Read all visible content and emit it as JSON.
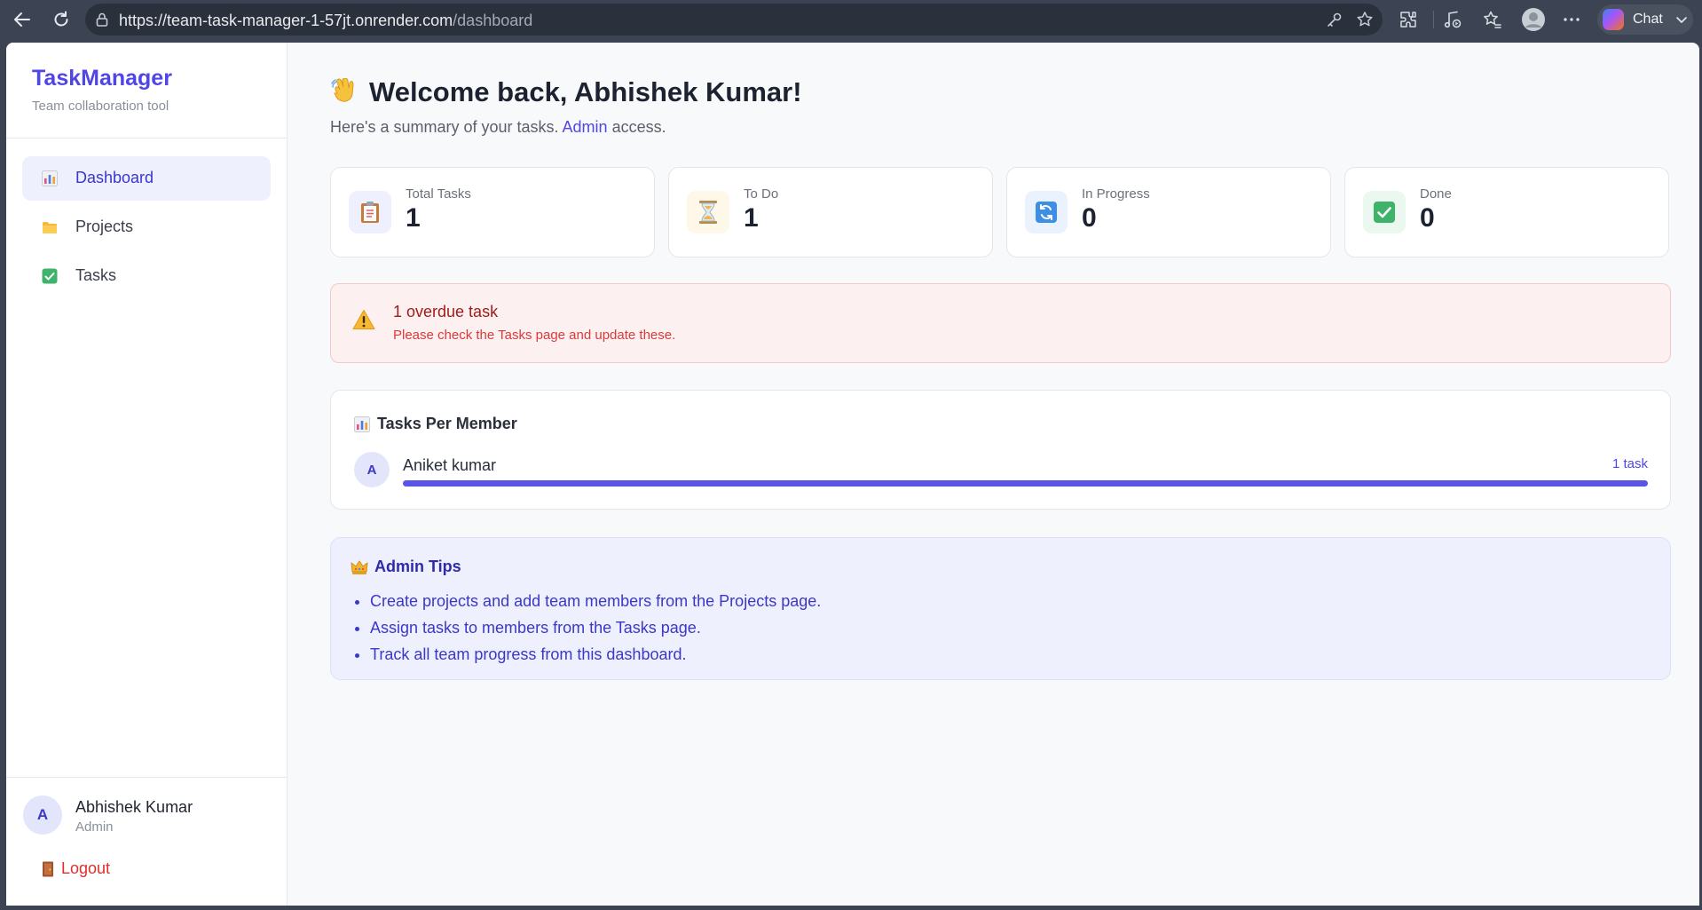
{
  "browser": {
    "url_base": "https://team-task-manager-1-57jt.onrender.com",
    "url_path": "/dashboard",
    "chat_label": "Chat"
  },
  "sidebar": {
    "brand": "TaskManager",
    "tagline": "Team collaboration tool",
    "items": [
      {
        "label": "Dashboard",
        "icon": "bar-chart-icon",
        "active": true
      },
      {
        "label": "Projects",
        "icon": "folder-icon",
        "active": false
      },
      {
        "label": "Tasks",
        "icon": "checkbox-icon",
        "active": false
      }
    ],
    "user": {
      "initial": "A",
      "name": "Abhishek Kumar",
      "role": "Admin"
    },
    "logout_label": "Logout"
  },
  "main": {
    "welcome_title": "Welcome back, Abhishek Kumar!",
    "welcome_sub_prefix": "Here's a summary of your tasks.",
    "welcome_role": "Admin",
    "welcome_sub_suffix": "access.",
    "stats": [
      {
        "label": "Total Tasks",
        "value": "1",
        "icon": "clipboard-icon",
        "bg": "#eef0fd"
      },
      {
        "label": "To Do",
        "value": "1",
        "icon": "hourglass-icon",
        "bg": "#fdf8e8"
      },
      {
        "label": "In Progress",
        "value": "0",
        "icon": "refresh-icon",
        "bg": "#eaf3fd"
      },
      {
        "label": "Done",
        "value": "0",
        "icon": "check-icon",
        "bg": "#eaf8ef"
      }
    ],
    "alert": {
      "title": "1 overdue task",
      "message": "Please check the Tasks page and update these."
    },
    "members_panel": {
      "title": "Tasks Per Member",
      "members": [
        {
          "initial": "A",
          "name": "Aniket kumar",
          "count_label": "1 task",
          "share": 1.0
        }
      ]
    },
    "tips": {
      "title": "Admin Tips",
      "items": [
        "Create projects and add team members from the Projects page.",
        "Assign tasks to members from the Tasks page.",
        "Track all team progress from this dashboard."
      ]
    }
  },
  "colors": {
    "accent": "#4f46e5",
    "danger": "#dc2f2f",
    "alert_bg": "#fdf0f0"
  }
}
